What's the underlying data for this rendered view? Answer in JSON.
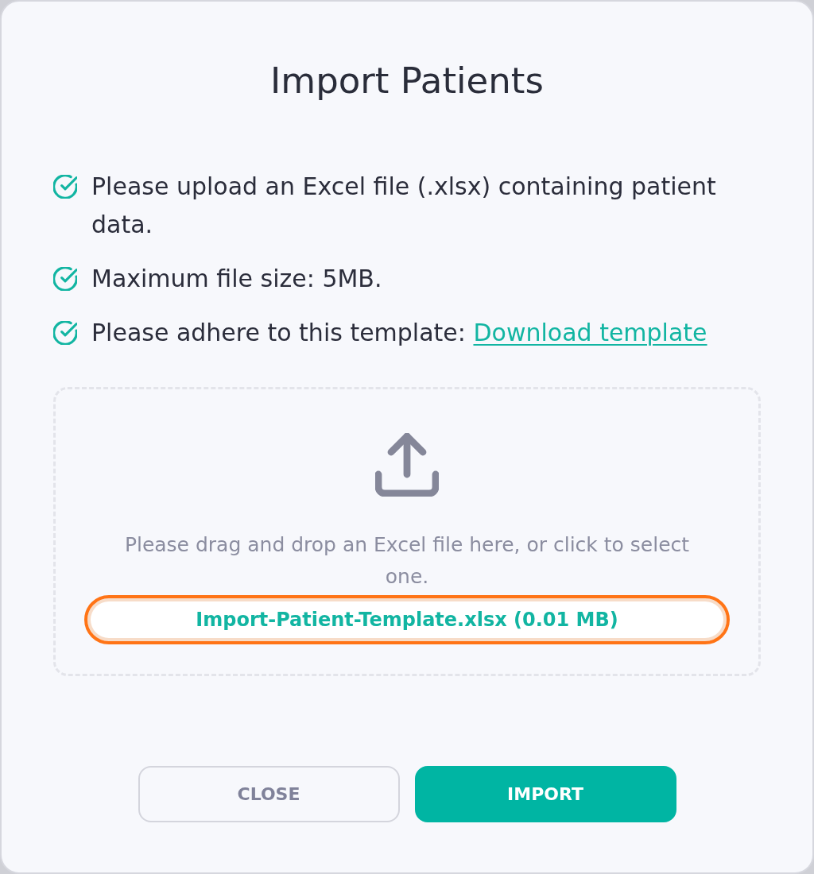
{
  "dialog": {
    "title": "Import Patients"
  },
  "requirements": [
    {
      "text": "Please upload an Excel file (.xlsx) containing patient data."
    },
    {
      "text": "Maximum file size: 5MB."
    },
    {
      "text": "Please adhere to this template:",
      "link": "Download template"
    }
  ],
  "dropzone": {
    "hint": "Please drag and drop an Excel file here, or click to select one.",
    "file": {
      "name": "Import-Patient-Template.xlsx (0.01 MB)",
      "highlighted": true
    }
  },
  "buttons": [
    {
      "label": "CLOSE",
      "kind": "secondary"
    },
    {
      "label": "IMPORT",
      "kind": "primary"
    }
  ]
}
